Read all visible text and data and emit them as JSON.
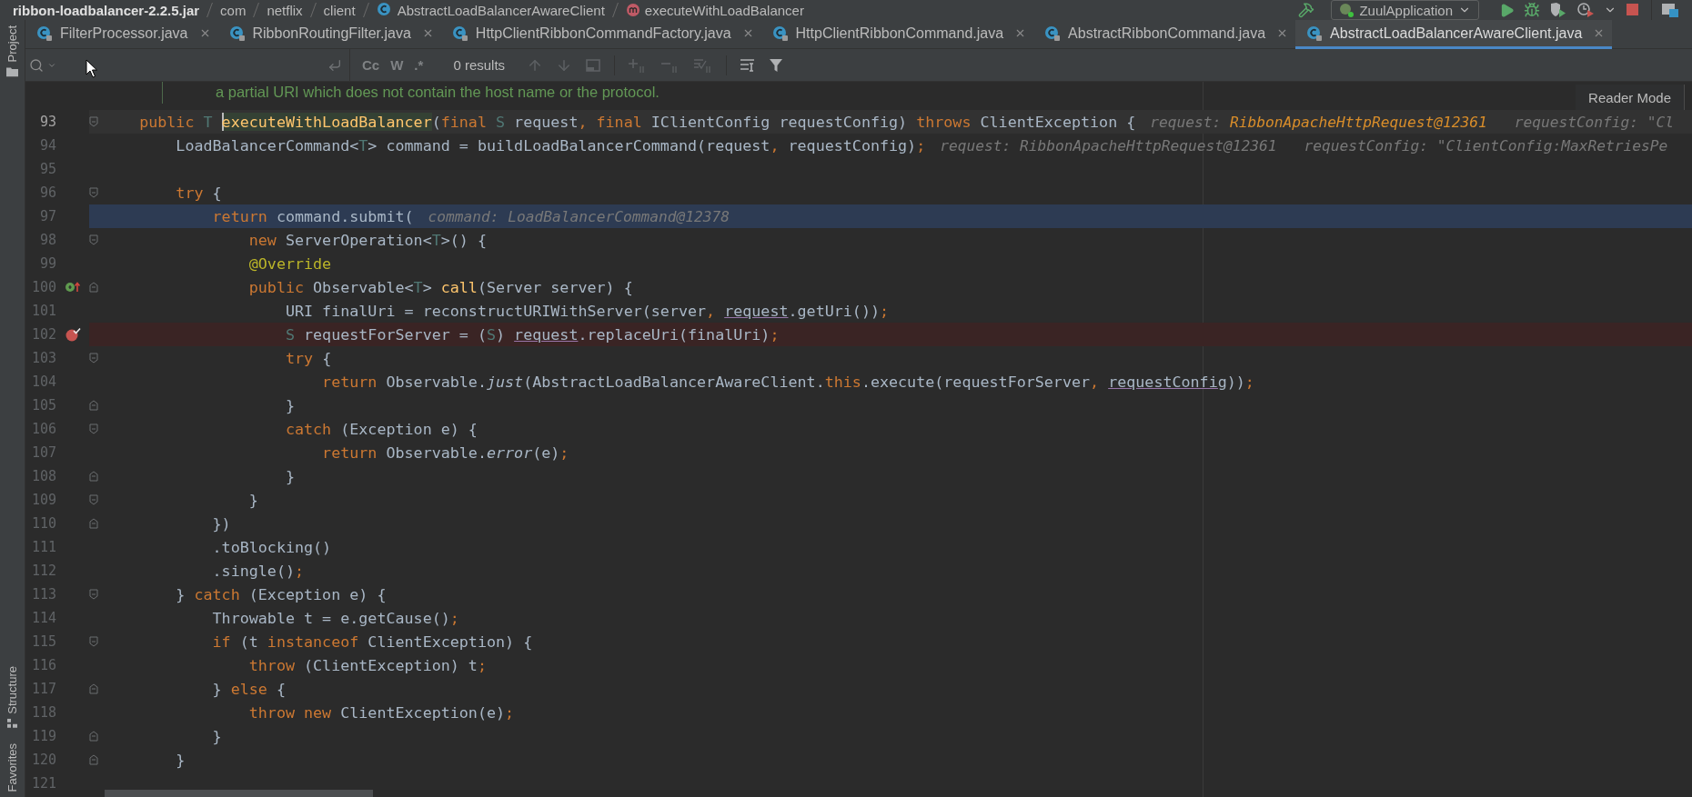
{
  "breadcrumbs": [
    {
      "kind": "jar",
      "label": "ribbon-loadbalancer-2.2.5.jar"
    },
    {
      "kind": "package",
      "label": "com"
    },
    {
      "kind": "package",
      "label": "netflix"
    },
    {
      "kind": "package",
      "label": "client"
    },
    {
      "kind": "class",
      "label": "AbstractLoadBalancerAwareClient"
    },
    {
      "kind": "method",
      "label": "executeWithLoadBalancer"
    }
  ],
  "run_toolbar": {
    "configuration": "ZuulApplication"
  },
  "tool_windows": {
    "top": [
      {
        "kind": "project",
        "label": "Project"
      }
    ],
    "bottom": [
      {
        "kind": "structure",
        "label": "Structure"
      },
      {
        "kind": "favorites",
        "label": "Favorites"
      }
    ]
  },
  "tabs": [
    {
      "label": "FilterProcessor.java",
      "selected": false
    },
    {
      "label": "RibbonRoutingFilter.java",
      "selected": false
    },
    {
      "label": "HttpClientRibbonCommandFactory.java",
      "selected": false
    },
    {
      "label": "HttpClientRibbonCommand.java",
      "selected": false
    },
    {
      "label": "AbstractRibbonCommand.java",
      "selected": false
    },
    {
      "label": "AbstractLoadBalancerAwareClient.java",
      "selected": true
    }
  ],
  "search": {
    "toggles": [
      {
        "label": "Cc",
        "selected": false
      },
      {
        "label": "W",
        "selected": false
      },
      {
        "label": ".*",
        "selected": false
      }
    ],
    "results": "0 results"
  },
  "editor": {
    "doc_comment": "a partial URI which does not contain the host name or the protocol.",
    "reader_mode": "Reader Mode",
    "lines": [
      {
        "number": "93",
        "current": true,
        "execution_point": false,
        "breakpoint": false,
        "override_marker": false,
        "fold_start": true,
        "fold_end": false,
        "segments": [
          {
            "kind": "keyword",
            "text": "    public "
          },
          {
            "kind": "type_param",
            "text": "T "
          },
          {
            "kind": "method_decl",
            "text": "executeWithLoadBalancer"
          },
          {
            "kind": "text",
            "text": "("
          },
          {
            "kind": "keyword",
            "text": "final "
          },
          {
            "kind": "type_param",
            "text": "S "
          },
          {
            "kind": "text",
            "text": "request"
          },
          {
            "kind": "punct",
            "text": ", "
          },
          {
            "kind": "keyword",
            "text": "final "
          },
          {
            "kind": "text",
            "text": "IClientConfig requestConfig) "
          },
          {
            "kind": "keyword",
            "text": "throws "
          },
          {
            "kind": "text",
            "text": "ClientException {"
          }
        ],
        "hints": [
          {
            "kind": "changed",
            "name": "request: ",
            "value": "RibbonApacheHttpRequest@12361"
          },
          {
            "kind": "plain",
            "name": "requestConfig: ",
            "value": "\"Cl"
          }
        ]
      },
      {
        "number": "94",
        "current": false,
        "execution_point": false,
        "breakpoint": false,
        "override_marker": false,
        "fold_start": false,
        "fold_end": false,
        "segments": [
          {
            "kind": "text",
            "text": "        LoadBalancerCommand<"
          },
          {
            "kind": "type_param",
            "text": "T"
          },
          {
            "kind": "text",
            "text": "> command = buildLoadBalancerCommand(request"
          },
          {
            "kind": "punct",
            "text": ", "
          },
          {
            "kind": "text",
            "text": "requestConfig)"
          },
          {
            "kind": "punct",
            "text": ";"
          }
        ],
        "hints": [
          {
            "kind": "plain",
            "name": "request: ",
            "value": "RibbonApacheHttpRequest@12361"
          },
          {
            "kind": "plain",
            "name": "requestConfig: ",
            "value": "\"ClientConfig:MaxRetriesPe"
          }
        ]
      },
      {
        "number": "95",
        "current": false,
        "execution_point": false,
        "breakpoint": false,
        "override_marker": false,
        "fold_start": false,
        "fold_end": false
      },
      {
        "number": "96",
        "current": false,
        "execution_point": false,
        "breakpoint": false,
        "override_marker": false,
        "fold_start": true,
        "fold_end": false,
        "segments": [
          {
            "kind": "keyword",
            "text": "        try "
          },
          {
            "kind": "text",
            "text": "{"
          }
        ]
      },
      {
        "number": "97",
        "current": false,
        "execution_point": true,
        "breakpoint": false,
        "override_marker": false,
        "fold_start": false,
        "fold_end": false,
        "segments": [
          {
            "kind": "keyword",
            "text": "            return "
          },
          {
            "kind": "text",
            "text": "command.submit("
          }
        ],
        "hints": [
          {
            "kind": "plain",
            "name": "command: ",
            "value": "LoadBalancerCommand@12378"
          }
        ]
      },
      {
        "number": "98",
        "current": false,
        "execution_point": false,
        "breakpoint": false,
        "override_marker": false,
        "fold_start": true,
        "fold_end": false,
        "segments": [
          {
            "kind": "keyword",
            "text": "                new "
          },
          {
            "kind": "text",
            "text": "ServerOperation<"
          },
          {
            "kind": "type_param",
            "text": "T"
          },
          {
            "kind": "text",
            "text": ">() {"
          }
        ]
      },
      {
        "number": "99",
        "current": false,
        "execution_point": false,
        "breakpoint": false,
        "override_marker": false,
        "fold_start": false,
        "fold_end": false,
        "segments": [
          {
            "kind": "annotation",
            "text": "                @Override"
          }
        ]
      },
      {
        "number": "100",
        "current": false,
        "execution_point": false,
        "breakpoint": false,
        "override_marker": true,
        "fold_start": false,
        "fold_end": true,
        "segments": [
          {
            "kind": "keyword",
            "text": "                public "
          },
          {
            "kind": "text",
            "text": "Observable<"
          },
          {
            "kind": "type_param",
            "text": "T"
          },
          {
            "kind": "text",
            "text": "> "
          },
          {
            "kind": "method_decl",
            "text": "call"
          },
          {
            "kind": "text",
            "text": "(Server server) {"
          }
        ]
      },
      {
        "number": "101",
        "current": false,
        "execution_point": false,
        "breakpoint": false,
        "override_marker": false,
        "fold_start": false,
        "fold_end": false,
        "segments": [
          {
            "kind": "text",
            "text": "                    URI finalUri = reconstructURIWithServer(server"
          },
          {
            "kind": "punct",
            "text": ", "
          },
          {
            "kind": "param_ref",
            "text": "request"
          },
          {
            "kind": "text",
            "text": ".getUri())"
          },
          {
            "kind": "punct",
            "text": ";"
          }
        ]
      },
      {
        "number": "102",
        "current": false,
        "execution_point": false,
        "breakpoint": true,
        "override_marker": false,
        "fold_start": false,
        "fold_end": false,
        "segments": [
          {
            "kind": "type_param",
            "text": "                    S"
          },
          {
            "kind": "text",
            "text": " requestForServer = ("
          },
          {
            "kind": "type_param",
            "text": "S"
          },
          {
            "kind": "text",
            "text": ") "
          },
          {
            "kind": "param_ref",
            "text": "request"
          },
          {
            "kind": "text",
            "text": ".replaceUri(finalUri)"
          },
          {
            "kind": "punct",
            "text": ";"
          }
        ]
      },
      {
        "number": "103",
        "current": false,
        "execution_point": false,
        "breakpoint": false,
        "override_marker": false,
        "fold_start": true,
        "fold_end": false,
        "segments": [
          {
            "kind": "keyword",
            "text": "                    try "
          },
          {
            "kind": "text",
            "text": "{"
          }
        ]
      },
      {
        "number": "104",
        "current": false,
        "execution_point": false,
        "breakpoint": false,
        "override_marker": false,
        "fold_start": false,
        "fold_end": false,
        "segments": [
          {
            "kind": "keyword",
            "text": "                        return "
          },
          {
            "kind": "text",
            "text": "Observable."
          },
          {
            "kind": "static_call",
            "text": "just"
          },
          {
            "kind": "text",
            "text": "(AbstractLoadBalancerAwareClient."
          },
          {
            "kind": "keyword",
            "text": "this"
          },
          {
            "kind": "text",
            "text": ".execute(requestForServer"
          },
          {
            "kind": "punct",
            "text": ", "
          },
          {
            "kind": "param_ref",
            "text": "requestConfig"
          },
          {
            "kind": "text",
            "text": "))"
          },
          {
            "kind": "punct",
            "text": ";"
          }
        ]
      },
      {
        "number": "105",
        "current": false,
        "execution_point": false,
        "breakpoint": false,
        "override_marker": false,
        "fold_start": false,
        "fold_end": true,
        "segments": [
          {
            "kind": "text",
            "text": "                    }"
          }
        ]
      },
      {
        "number": "106",
        "current": false,
        "execution_point": false,
        "breakpoint": false,
        "override_marker": false,
        "fold_start": true,
        "fold_end": false,
        "segments": [
          {
            "kind": "keyword",
            "text": "                    catch "
          },
          {
            "kind": "text",
            "text": "(Exception e) {"
          }
        ]
      },
      {
        "number": "107",
        "current": false,
        "execution_point": false,
        "breakpoint": false,
        "override_marker": false,
        "fold_start": false,
        "fold_end": false,
        "segments": [
          {
            "kind": "keyword",
            "text": "                        return "
          },
          {
            "kind": "text",
            "text": "Observable."
          },
          {
            "kind": "static_call",
            "text": "error"
          },
          {
            "kind": "text",
            "text": "(e)"
          },
          {
            "kind": "punct",
            "text": ";"
          }
        ]
      },
      {
        "number": "108",
        "current": false,
        "execution_point": false,
        "breakpoint": false,
        "override_marker": false,
        "fold_start": false,
        "fold_end": true,
        "segments": [
          {
            "kind": "text",
            "text": "                    }"
          }
        ]
      },
      {
        "number": "109",
        "current": false,
        "execution_point": false,
        "breakpoint": false,
        "override_marker": false,
        "fold_start": true,
        "fold_end": false,
        "segments": [
          {
            "kind": "text",
            "text": "                }"
          }
        ]
      },
      {
        "number": "110",
        "current": false,
        "execution_point": false,
        "breakpoint": false,
        "override_marker": false,
        "fold_start": false,
        "fold_end": true,
        "segments": [
          {
            "kind": "text",
            "text": "            })"
          }
        ]
      },
      {
        "number": "111",
        "current": false,
        "execution_point": false,
        "breakpoint": false,
        "override_marker": false,
        "fold_start": false,
        "fold_end": false,
        "segments": [
          {
            "kind": "text",
            "text": "            .toBlocking()"
          }
        ]
      },
      {
        "number": "112",
        "current": false,
        "execution_point": false,
        "breakpoint": false,
        "override_marker": false,
        "fold_start": false,
        "fold_end": false,
        "segments": [
          {
            "kind": "text",
            "text": "            .single()"
          },
          {
            "kind": "punct",
            "text": ";"
          }
        ]
      },
      {
        "number": "113",
        "current": false,
        "execution_point": false,
        "breakpoint": false,
        "override_marker": false,
        "fold_start": true,
        "fold_end": false,
        "segments": [
          {
            "kind": "text",
            "text": "        } "
          },
          {
            "kind": "keyword",
            "text": "catch "
          },
          {
            "kind": "text",
            "text": "(Exception e) {"
          }
        ]
      },
      {
        "number": "114",
        "current": false,
        "execution_point": false,
        "breakpoint": false,
        "override_marker": false,
        "fold_start": false,
        "fold_end": false,
        "segments": [
          {
            "kind": "text",
            "text": "            Throwable t = e.getCause()"
          },
          {
            "kind": "punct",
            "text": ";"
          }
        ]
      },
      {
        "number": "115",
        "current": false,
        "execution_point": false,
        "breakpoint": false,
        "override_marker": false,
        "fold_start": true,
        "fold_end": false,
        "segments": [
          {
            "kind": "keyword",
            "text": "            if "
          },
          {
            "kind": "text",
            "text": "(t "
          },
          {
            "kind": "keyword",
            "text": "instanceof "
          },
          {
            "kind": "text",
            "text": "ClientException) {"
          }
        ]
      },
      {
        "number": "116",
        "current": false,
        "execution_point": false,
        "breakpoint": false,
        "override_marker": false,
        "fold_start": false,
        "fold_end": false,
        "segments": [
          {
            "kind": "keyword",
            "text": "                throw "
          },
          {
            "kind": "text",
            "text": "(ClientException) t"
          },
          {
            "kind": "punct",
            "text": ";"
          }
        ]
      },
      {
        "number": "117",
        "current": false,
        "execution_point": false,
        "breakpoint": false,
        "override_marker": false,
        "fold_start": false,
        "fold_end": true,
        "segments": [
          {
            "kind": "text",
            "text": "            } "
          },
          {
            "kind": "keyword",
            "text": "else "
          },
          {
            "kind": "text",
            "text": "{"
          }
        ]
      },
      {
        "number": "118",
        "current": false,
        "execution_point": false,
        "breakpoint": false,
        "override_marker": false,
        "fold_start": false,
        "fold_end": false,
        "segments": [
          {
            "kind": "keyword",
            "text": "                throw new "
          },
          {
            "kind": "text",
            "text": "ClientException(e)"
          },
          {
            "kind": "punct",
            "text": ";"
          }
        ]
      },
      {
        "number": "119",
        "current": false,
        "execution_point": false,
        "breakpoint": false,
        "override_marker": false,
        "fold_start": false,
        "fold_end": true,
        "segments": [
          {
            "kind": "text",
            "text": "            }"
          }
        ]
      },
      {
        "number": "120",
        "current": false,
        "execution_point": false,
        "breakpoint": false,
        "override_marker": false,
        "fold_start": false,
        "fold_end": true,
        "segments": [
          {
            "kind": "text",
            "text": "        }"
          }
        ]
      },
      {
        "number": "121",
        "current": false,
        "execution_point": false,
        "breakpoint": false,
        "override_marker": false,
        "fold_start": false,
        "fold_end": false
      }
    ]
  }
}
